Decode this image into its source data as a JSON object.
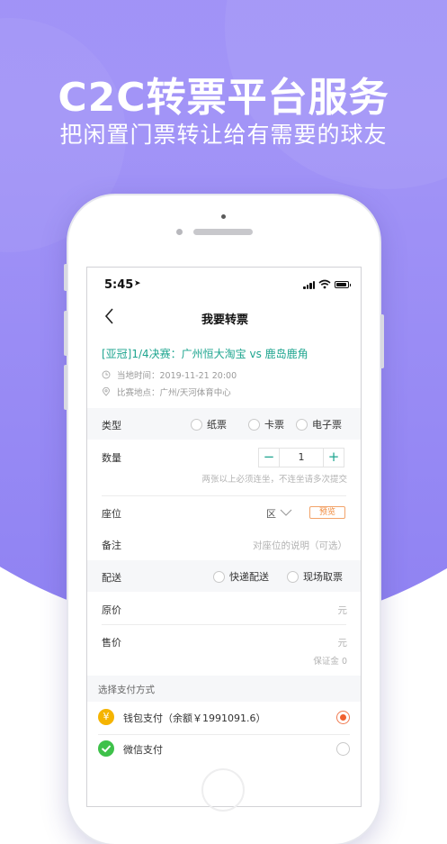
{
  "banner": {
    "headline": "C2C转票平台服务",
    "subline": "把闲置门票转让给有需要的球友"
  },
  "status_bar": {
    "time": "5:45",
    "location_glyph": "➤"
  },
  "nav": {
    "title": "我要转票",
    "back_icon": "chevron-left-icon"
  },
  "match": {
    "title": "[亚冠]1/4决赛：广州恒大淘宝 vs 鹿岛鹿角",
    "time_label": "当地时间：2019-11-21 20:00",
    "venue_label": "比赛地点：广州/天河体育中心"
  },
  "form": {
    "type": {
      "label": "类型",
      "options": [
        "纸票",
        "卡票",
        "电子票"
      ]
    },
    "quantity": {
      "label": "数量",
      "value": "1",
      "minus": "−",
      "plus": "+",
      "hint": "两张以上必须连坐，不连坐请多次提交"
    },
    "seat": {
      "label": "座位",
      "area_suffix": "区",
      "preview": "预览"
    },
    "note": {
      "label": "备注",
      "placeholder": "对座位的说明（可选）"
    },
    "delivery": {
      "label": "配送",
      "options": [
        "快递配送",
        "现场取票"
      ]
    },
    "original_price": {
      "label": "原价",
      "unit": "元"
    },
    "sale_price": {
      "label": "售价",
      "unit": "元",
      "deposit": "保证金 0"
    }
  },
  "payment": {
    "section_title": "选择支付方式",
    "methods": [
      {
        "label": "钱包支付（余额￥1991091.6）",
        "icon": "wallet-yen-icon",
        "color": "#f5b400",
        "selected": true
      },
      {
        "label": "微信支付",
        "icon": "wechat-check-icon",
        "color": "#3ec14a",
        "selected": false
      }
    ]
  },
  "colors": {
    "accent": "#1ea58f",
    "brand_purple": "#9b8ff5",
    "warning": "#f0602e"
  }
}
